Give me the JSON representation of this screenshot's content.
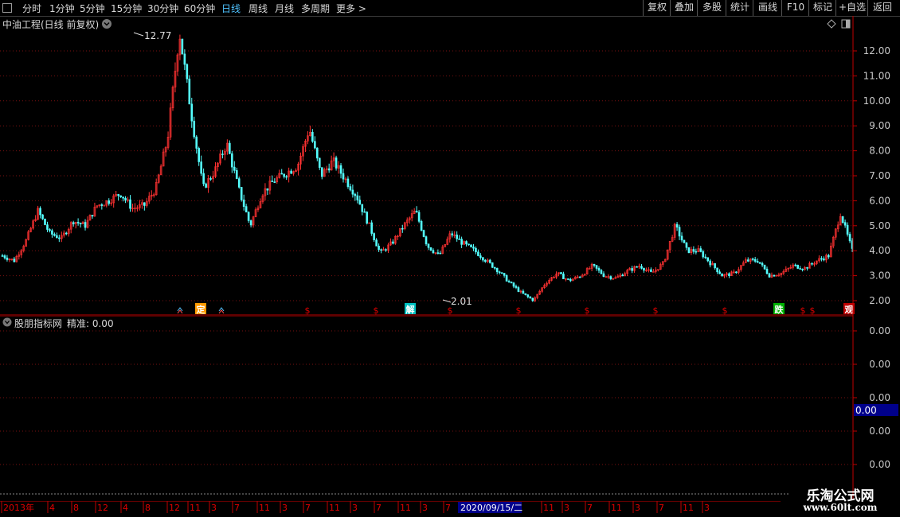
{
  "toolbar": {
    "periods": [
      "分时",
      "1分钟",
      "5分钟",
      "15分钟",
      "30分钟",
      "60分钟",
      "日线",
      "周线",
      "月线",
      "多周期",
      "更多 >"
    ],
    "active_period": "日线",
    "right_buttons": [
      "复权",
      "叠加",
      "多股",
      "统计",
      "画线",
      "F10",
      "标记",
      "+自选",
      "返回"
    ]
  },
  "main_panel": {
    "title": "中油工程(日线 前复权)",
    "high_label": "12.77",
    "low_label": "2.01",
    "y_ticks": [
      "12.00",
      "11.00",
      "10.00",
      "9.00",
      "8.00",
      "7.00",
      "6.00",
      "5.00",
      "4.00",
      "3.00",
      "2.00"
    ],
    "event_markers": [
      "定",
      "解",
      "跌",
      "观"
    ]
  },
  "indicator_panel": {
    "title": "股朋指标网",
    "value_label": "精准: 0.00",
    "y_ticks": [
      "0.00",
      "0.00",
      "0.00",
      "0.00",
      "0.00"
    ],
    "current_value": "0.00"
  },
  "date_axis": {
    "labels": [
      "2013年",
      "4",
      "8",
      "12",
      "4",
      "8",
      "12",
      "11",
      "3",
      "7",
      "11",
      "3",
      "7",
      "11",
      "3",
      "7",
      "11",
      "3",
      "7",
      "11",
      "3",
      "7",
      "11",
      "3",
      "7",
      "11",
      "3"
    ],
    "highlight": "2020/09/15/二"
  },
  "watermark": {
    "line1": "乐淘公式网",
    "line2": "www.60lt.com"
  },
  "chart_data": {
    "type": "candlestick",
    "ylim": [
      1.8,
      13.2
    ],
    "approx_close_path": [
      3.8,
      3.6,
      4.4,
      5.6,
      4.7,
      4.5,
      5.2,
      5.0,
      5.8,
      6.0,
      6.3,
      5.7,
      5.8,
      6.5,
      8.5,
      12.77,
      9.5,
      6.5,
      7.2,
      8.3,
      6.5,
      5.0,
      6.3,
      6.8,
      7.1,
      7.4,
      8.9,
      7.0,
      7.6,
      6.9,
      6.2,
      5.1,
      3.9,
      4.3,
      5.0,
      5.6,
      4.2,
      3.8,
      4.7,
      4.3,
      4.0,
      3.6,
      3.2,
      2.7,
      2.3,
      2.01,
      2.7,
      3.1,
      2.8,
      3.0,
      3.4,
      3.0,
      2.9,
      3.2,
      3.4,
      3.1,
      3.5,
      5.0,
      4.0,
      4.0,
      3.5,
      3.0,
      3.1,
      3.6,
      3.6,
      3.0,
      3.1,
      3.4,
      3.3,
      3.6,
      3.8,
      5.5,
      4.0
    ]
  }
}
